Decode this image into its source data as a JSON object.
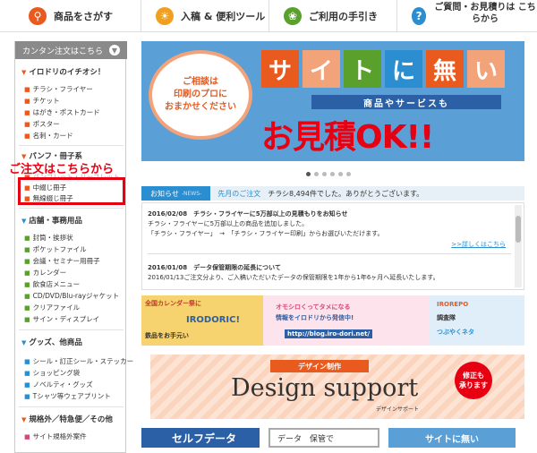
{
  "topnav": {
    "items": [
      {
        "label": "商品をさがす",
        "icon": "search-icon",
        "color": "#e85a1e"
      },
      {
        "label": "入稿 & 便利ツール",
        "icon": "lightbulb-icon",
        "color": "#f0a020"
      },
      {
        "label": "ご利用の手引き",
        "icon": "leaf-icon",
        "color": "#5aa02c"
      },
      {
        "label": "ご質問・お見積りは こちらから",
        "icon": "question-icon",
        "color": "#2a8ed0"
      }
    ]
  },
  "sidebar": {
    "header": "カンタン注文はこちら",
    "section1": {
      "title": "イロドリのイチオシ！",
      "items": [
        "チラシ・フライヤー",
        "チケット",
        "はがき・ポストカード",
        "ポスター",
        "名刺・カード"
      ]
    },
    "section2": {
      "title": "パンフ・冊子系",
      "items": [
        "パンフレット・リーフレット",
        "中綴じ冊子",
        "無線綴じ冊子"
      ]
    },
    "callout": "ご注文はこちらから",
    "section3": {
      "title": "店舗・事務用品",
      "items": [
        "封筒・挨拶状",
        "ポケットファイル",
        "会議・セミナー用冊子",
        "カレンダー",
        "飲食店メニュー",
        "CD/DVD/Blu-rayジャケット",
        "クリアファイル",
        "サイン・ディスプレイ"
      ]
    },
    "section4": {
      "title": "グッズ、他商品",
      "items": [
        "シール・訂正シール・ステッカー",
        "ショッピング袋",
        "ノベルティ・グッズ",
        "Tシャツ等ウェアプリント"
      ]
    },
    "section5": {
      "title": "規格外／特急便／その他",
      "items": [
        "サイト規格外案件"
      ]
    }
  },
  "banner": {
    "bubble_lines": [
      "ご相談は",
      "印刷のプロに",
      "おまかせください"
    ],
    "tiles": [
      "サ",
      "イ",
      "ト",
      "に",
      "無",
      "い"
    ],
    "tile_colors": [
      "#e85a1e",
      "#f3a37a",
      "#5aa02c",
      "#2a8ed0",
      "#e85a1e",
      "#f3a37a"
    ],
    "subtitle": "商品やサービスも",
    "headline": "お見積OK!!"
  },
  "news": {
    "tab": "お知らせ",
    "tab_sub": "-NEWS-",
    "tab2": "先月のご注文",
    "message": "チラシ8,494件でした。ありがとうございます。",
    "entries": [
      {
        "title": "2016/02/08　チラシ・フライヤーに5万部以上の見積もりをお知らせ",
        "body1": "チラシ・フライヤーに5万部以上の商品を追加しました。",
        "body2": "「チラシ・フライヤー」　→　「チラシ・フライヤー印刷」からお選びいただけます。",
        "link": ">>詳しくはこちら"
      },
      {
        "title": "2016/01/08　データ保管期限の延長について",
        "body1": "2016/01/13ご注文分より、ご入稿いただいたデータの保管期限を1年から1年6ヶ月へ延長いたします。"
      }
    ]
  },
  "promos": {
    "p1": [
      "全国カレンダー祭に",
      "IRODORIC!",
      "鉄品をお手元い"
    ],
    "p2": [
      "オモシロくってタメになる",
      "情報をイロドリから発信中!",
      "http://blog.iro-dori.net/"
    ],
    "p3": [
      "IROREPO",
      "調査隊",
      "つぶやくネタ"
    ]
  },
  "design": {
    "ribbon": "デザイン制作",
    "title": "Design support",
    "sub": "デザインサポート",
    "badge_line1": "修正も",
    "badge_line2": "承ります"
  },
  "bottom": {
    "b1": "セルフデータ",
    "b2": "データ　保管で",
    "b3": "サイトに無い"
  }
}
